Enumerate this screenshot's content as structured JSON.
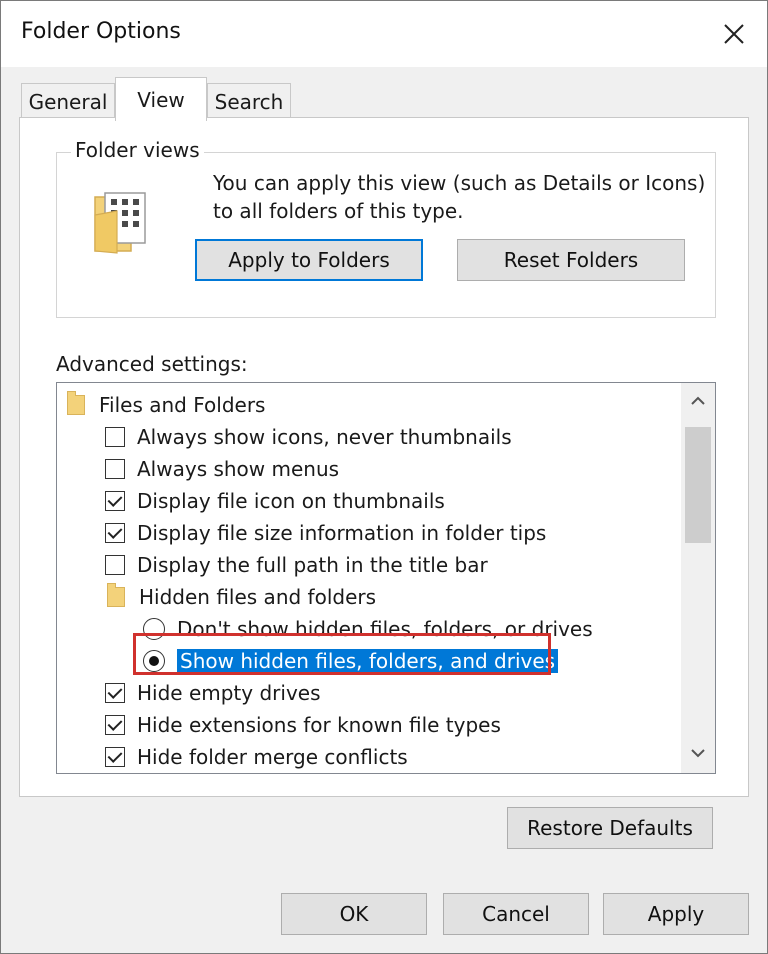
{
  "window": {
    "title": "Folder Options"
  },
  "tabs": [
    {
      "label": "General"
    },
    {
      "label": "View"
    },
    {
      "label": "Search"
    }
  ],
  "folder_views": {
    "title": "Folder views",
    "description": "You can apply this view (such as Details or Icons) to all folders of this type.",
    "apply_button": "Apply to Folders",
    "reset_button": "Reset Folders"
  },
  "advanced": {
    "label": "Advanced settings:",
    "items": [
      {
        "type": "folder",
        "label": "Files and Folders"
      },
      {
        "type": "checkbox",
        "label": "Always show icons, never thumbnails",
        "checked": false
      },
      {
        "type": "checkbox",
        "label": "Always show menus",
        "checked": false
      },
      {
        "type": "checkbox",
        "label": "Display file icon on thumbnails",
        "checked": true
      },
      {
        "type": "checkbox",
        "label": "Display file size information in folder tips",
        "checked": true
      },
      {
        "type": "checkbox",
        "label": "Display the full path in the title bar",
        "checked": false
      },
      {
        "type": "folder",
        "label": "Hidden files and folders"
      },
      {
        "type": "radio",
        "label": "Don't show hidden files, folders, or drives",
        "selected": false
      },
      {
        "type": "radio",
        "label": "Show hidden files, folders, and drives",
        "selected": true
      },
      {
        "type": "checkbox",
        "label": "Hide empty drives",
        "checked": true
      },
      {
        "type": "checkbox",
        "label": "Hide extensions for known file types",
        "checked": true
      },
      {
        "type": "checkbox",
        "label": "Hide folder merge conflicts",
        "checked": true
      }
    ]
  },
  "restore_defaults": "Restore Defaults",
  "footer": {
    "ok": "OK",
    "cancel": "Cancel",
    "apply": "Apply"
  },
  "colors": {
    "selection": "#0078d7",
    "highlight_box": "#d0312d",
    "folder": "#f3d27a"
  }
}
